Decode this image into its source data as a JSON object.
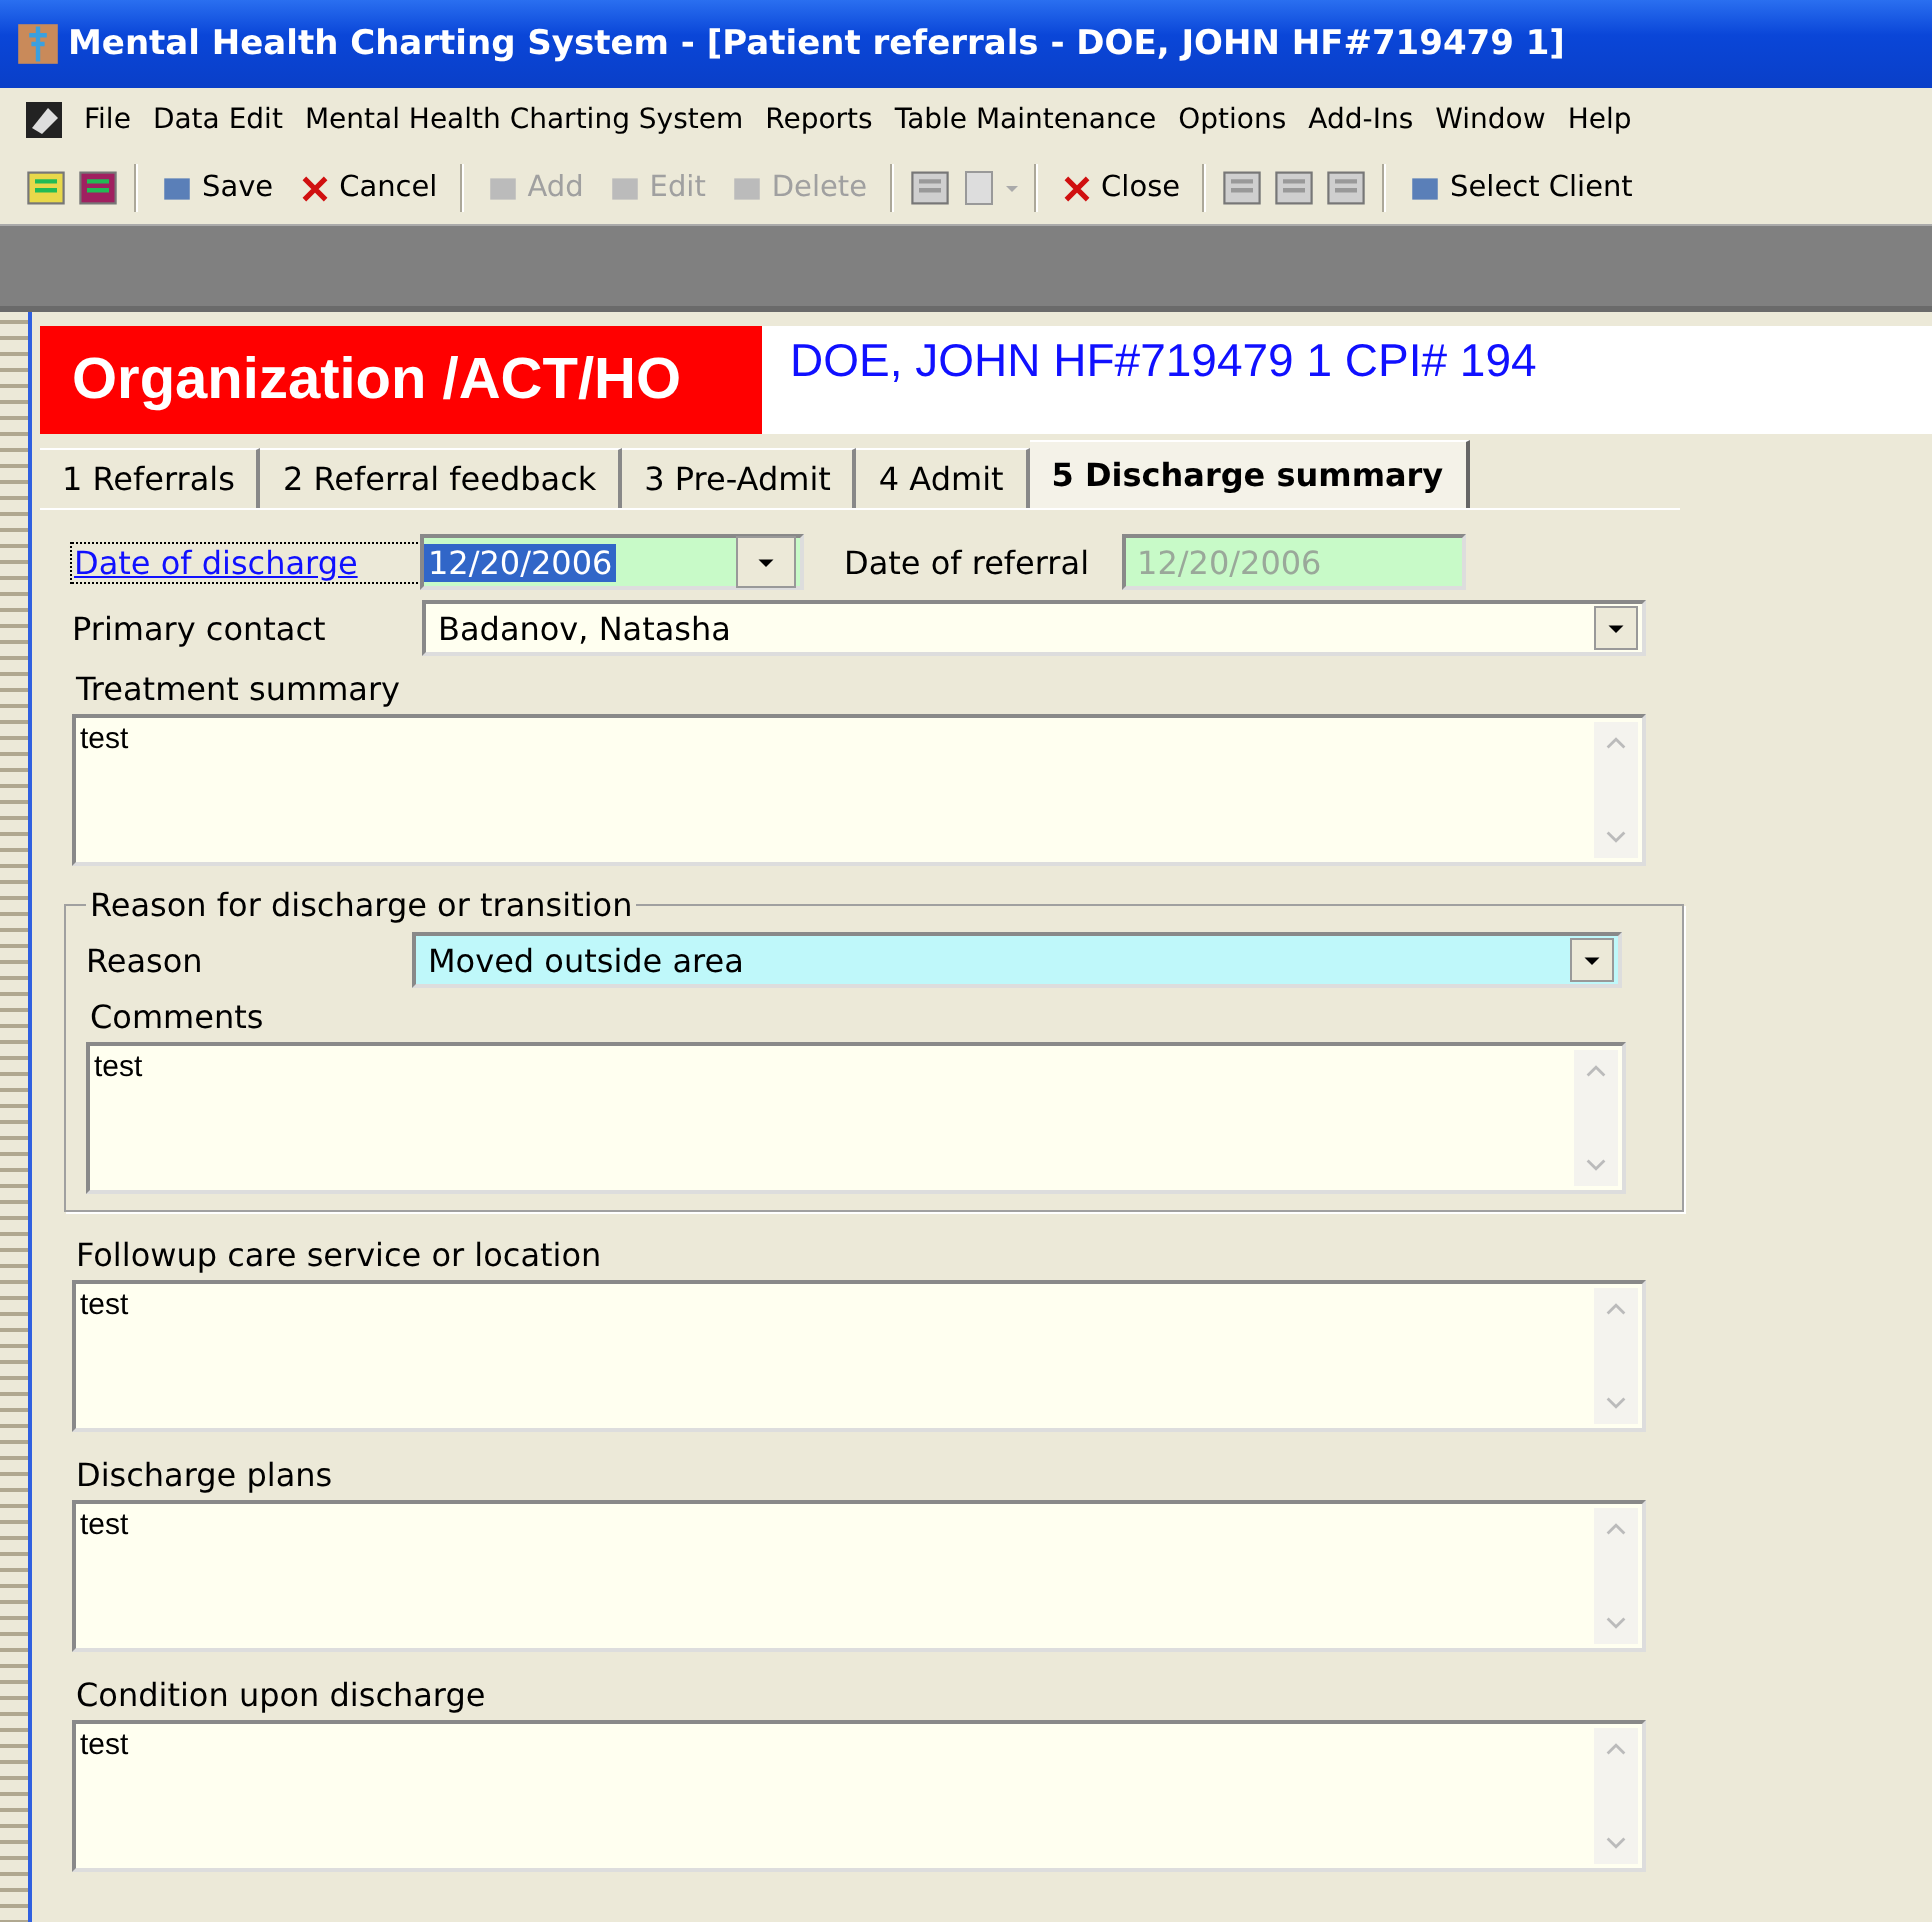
{
  "window": {
    "title": "Mental Health Charting System - [Patient referrals - DOE, JOHN  HF#719479 1]"
  },
  "menu": [
    "File",
    "Data Edit",
    "Mental Health Charting System",
    "Reports",
    "Table Maintenance",
    "Options",
    "Add-Ins",
    "Window",
    "Help"
  ],
  "toolbar": [
    {
      "kind": "icon",
      "disabled": false
    },
    {
      "kind": "icon",
      "disabled": false
    },
    {
      "kind": "separator"
    },
    {
      "kind": "button",
      "label": "Save",
      "disabled": false
    },
    {
      "kind": "button",
      "label": "Cancel",
      "disabled": false
    },
    {
      "kind": "separator"
    },
    {
      "kind": "button",
      "label": "Add",
      "disabled": true
    },
    {
      "kind": "button",
      "label": "Edit",
      "disabled": true
    },
    {
      "kind": "button",
      "label": "Delete",
      "disabled": true
    },
    {
      "kind": "separator"
    },
    {
      "kind": "icon",
      "disabled": true
    },
    {
      "kind": "dropdown",
      "disabled": true
    },
    {
      "kind": "separator"
    },
    {
      "kind": "button",
      "label": "Close",
      "disabled": false
    },
    {
      "kind": "separator"
    },
    {
      "kind": "icon",
      "disabled": true
    },
    {
      "kind": "icon",
      "disabled": true
    },
    {
      "kind": "icon",
      "disabled": true
    },
    {
      "kind": "separator"
    },
    {
      "kind": "button",
      "label": "Select Client",
      "disabled": false
    }
  ],
  "header": {
    "organization": "Organization /ACT/HO",
    "patient": "DOE, JOHN  HF#719479 1 CPI# 194"
  },
  "tabs": [
    {
      "label": "1 Referrals",
      "selected": false
    },
    {
      "label": "2 Referral feedback",
      "selected": false
    },
    {
      "label": "3 Pre-Admit",
      "selected": false
    },
    {
      "label": "4 Admit",
      "selected": false
    },
    {
      "label": "5 Discharge summary",
      "selected": true
    }
  ],
  "date_of_discharge": {
    "label": "Date of discharge",
    "value": "12/20/2006",
    "focused": true
  },
  "date_of_referral": {
    "label": "Date of referral",
    "value": "12/20/2006"
  },
  "primary_contact": {
    "label": "Primary contact",
    "value": "Badanov, Natasha"
  },
  "treatment_summary": {
    "label": "Treatment summary",
    "value": "test"
  },
  "reason_group": {
    "title": "Reason for discharge or transition",
    "reason": {
      "label": "Reason",
      "value": "Moved outside area"
    },
    "comments": {
      "label": "Comments",
      "value": "test"
    }
  },
  "memos": [
    {
      "label": "Followup care service or location",
      "value": "test"
    },
    {
      "label": "Discharge plans",
      "value": "test"
    },
    {
      "label": "Condition upon discharge",
      "value": "test"
    }
  ]
}
